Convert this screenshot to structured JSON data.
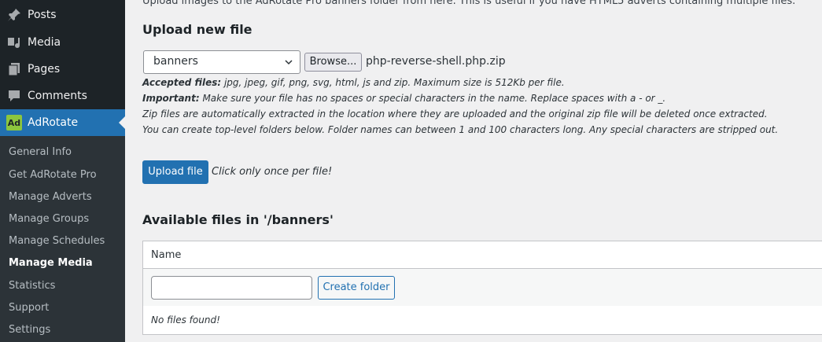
{
  "sidebar": {
    "menu": [
      {
        "label": "Posts",
        "icon": "pin-icon"
      },
      {
        "label": "Media",
        "icon": "media-icon"
      },
      {
        "label": "Pages",
        "icon": "pages-icon"
      },
      {
        "label": "Comments",
        "icon": "comment-icon"
      },
      {
        "label": "AdRotate",
        "icon": "adrotate-logo",
        "logo_text": "Ad"
      }
    ],
    "submenu": [
      {
        "label": "General Info"
      },
      {
        "label": "Get AdRotate Pro"
      },
      {
        "label": "Manage Adverts"
      },
      {
        "label": "Manage Groups"
      },
      {
        "label": "Manage Schedules"
      },
      {
        "label": "Manage Media"
      },
      {
        "label": "Statistics"
      },
      {
        "label": "Support"
      },
      {
        "label": "Settings"
      }
    ],
    "current_submenu": "Manage Media"
  },
  "main": {
    "intro": "Upload images to the AdRotate Pro banners folder from here. This is useful if you have HTML5 adverts containing multiple files.",
    "upload_heading": "Upload new file",
    "folder_select": {
      "selected": "banners"
    },
    "browse_label": "Browse...",
    "file_name": "php-reverse-shell.php.zip",
    "notes": {
      "accepted_label": "Accepted files:",
      "accepted_text": " jpg, jpeg, gif, png, svg, html, js and zip. Maximum size is 512Kb per file.",
      "important_label": "Important:",
      "important_text": " Make sure your file has no spaces or special characters in the name. Replace spaces with a - or _.",
      "zip_note": "Zip files are automatically extracted in the location where they are uploaded and the original zip file will be deleted once extracted.",
      "folder_note": "You can create top-level folders below. Folder names can between 1 and 100 characters long. Any special characters are stripped out."
    },
    "upload_button": "Upload file",
    "click_note": "Click only once per file!",
    "files_heading": "Available files in '/banners'",
    "table": {
      "column_name": "Name",
      "folder_input_value": "",
      "create_folder_button": "Create folder",
      "empty_text": "No files found!"
    }
  },
  "colors": {
    "sidebar_bg": "#1d2327",
    "submenu_bg": "#2c3338",
    "accent": "#2271b1",
    "adrotate_logo": "#8cc63e"
  }
}
